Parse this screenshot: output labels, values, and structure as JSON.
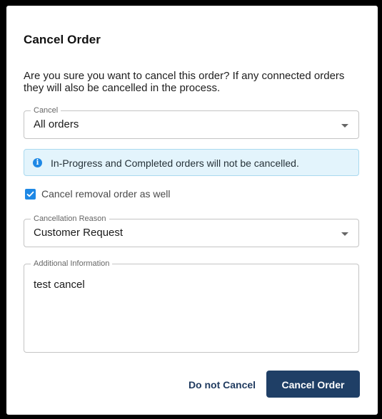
{
  "dialog": {
    "title": "Cancel Order",
    "prompt": "Are you sure you want to cancel this order? If any connected orders they will also be cancelled in the process."
  },
  "cancel_select": {
    "label": "Cancel",
    "value": "All orders"
  },
  "info": {
    "icon": "info-icon",
    "text": "In-Progress and Completed orders will not be cancelled."
  },
  "removal_checkbox": {
    "label": "Cancel removal order as well",
    "checked": true
  },
  "reason_select": {
    "label": "Cancellation Reason",
    "value": "Customer Request"
  },
  "additional_info": {
    "label": "Additional Information",
    "value": "test cancel"
  },
  "actions": {
    "secondary_label": "Do not Cancel",
    "primary_label": "Cancel Order"
  },
  "colors": {
    "primary": "#1f3f66",
    "accent": "#1e88e5",
    "info_background": "#e3f4fc"
  }
}
